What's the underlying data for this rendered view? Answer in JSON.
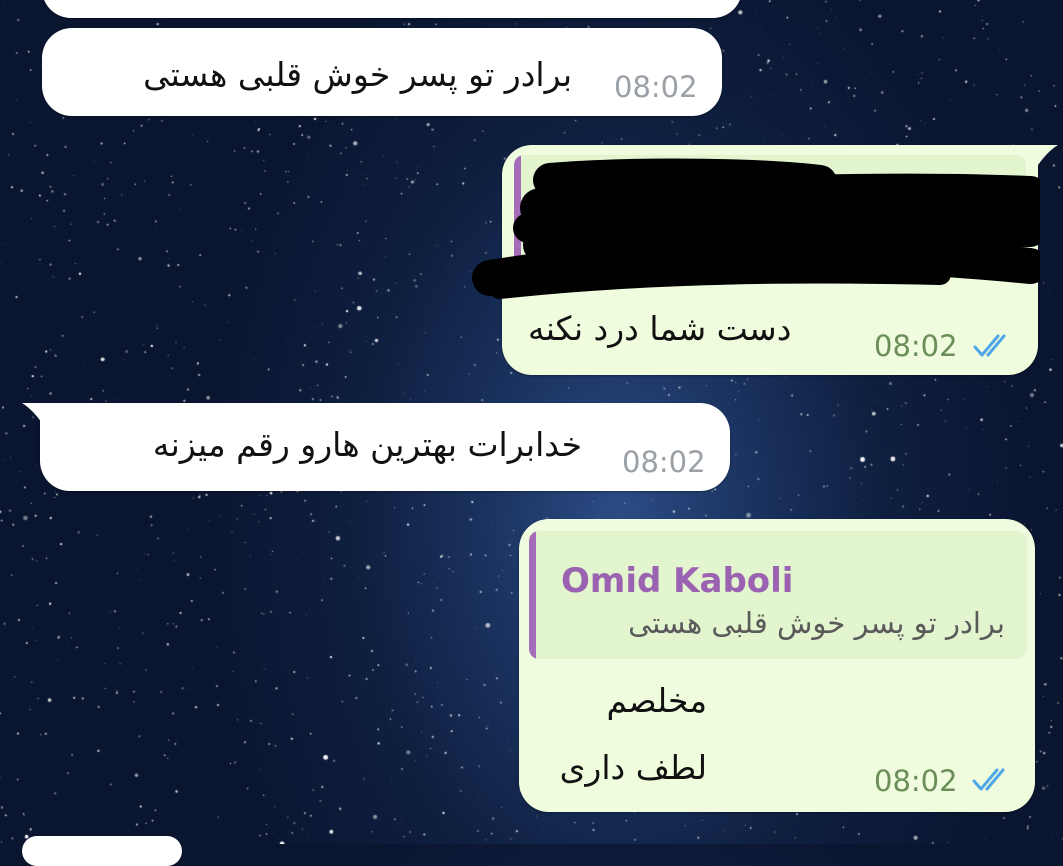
{
  "colors": {
    "incoming_bubble": "#ffffff",
    "outgoing_bubble": "#effdde",
    "reply_accent": "#a56db9",
    "read_ticks": "#4fa6e8"
  },
  "messages": [
    {
      "direction": "incoming",
      "text": "برادر تو پسر خوش قلبی هستی",
      "time": "08:02"
    },
    {
      "direction": "outgoing",
      "reply_redacted": true,
      "text": "دست شما درد نکنه",
      "time": "08:02",
      "status_icon": "double-check-icon"
    },
    {
      "direction": "incoming",
      "text": "خدابرات بهترین هارو رقم میزنه",
      "time": "08:02"
    },
    {
      "direction": "outgoing",
      "reply": {
        "author": "Omid Kaboli",
        "text": "برادر تو پسر خوش قلبی هستی"
      },
      "lines": [
        "مخلصم",
        "لطف داری"
      ],
      "time": "08:02",
      "status_icon": "double-check-icon"
    }
  ]
}
